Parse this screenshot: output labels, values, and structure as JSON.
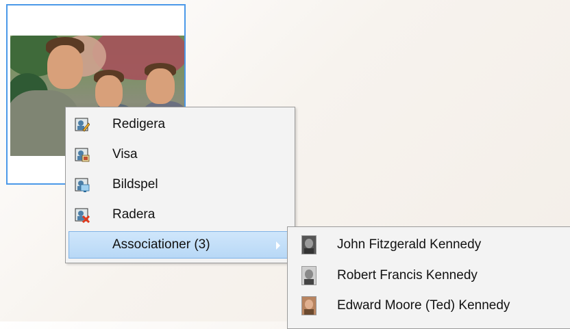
{
  "photo_card": {
    "alt": "Photo thumbnail"
  },
  "context_menu": {
    "items": [
      {
        "label": "Redigera",
        "icon": "edit-person-icon"
      },
      {
        "label": "Visa",
        "icon": "view-person-icon"
      },
      {
        "label": "Bildspel",
        "icon": "slideshow-person-icon"
      },
      {
        "label": "Radera",
        "icon": "delete-person-icon"
      },
      {
        "label": "Associationer (3)",
        "icon": "",
        "has_submenu": true
      }
    ]
  },
  "associations_submenu": {
    "items": [
      {
        "label": "John Fitzgerald Kennedy",
        "icon": "portrait-thumbnail-icon"
      },
      {
        "label": "Robert Francis Kennedy",
        "icon": "portrait-thumbnail-icon"
      },
      {
        "label": "Edward Moore (Ted) Kennedy",
        "icon": "portrait-thumbnail-icon"
      }
    ]
  },
  "colors": {
    "selection_border": "#4a98e8",
    "active_item_bg": "#b8d8f6",
    "menu_bg": "#f3f3f3"
  }
}
